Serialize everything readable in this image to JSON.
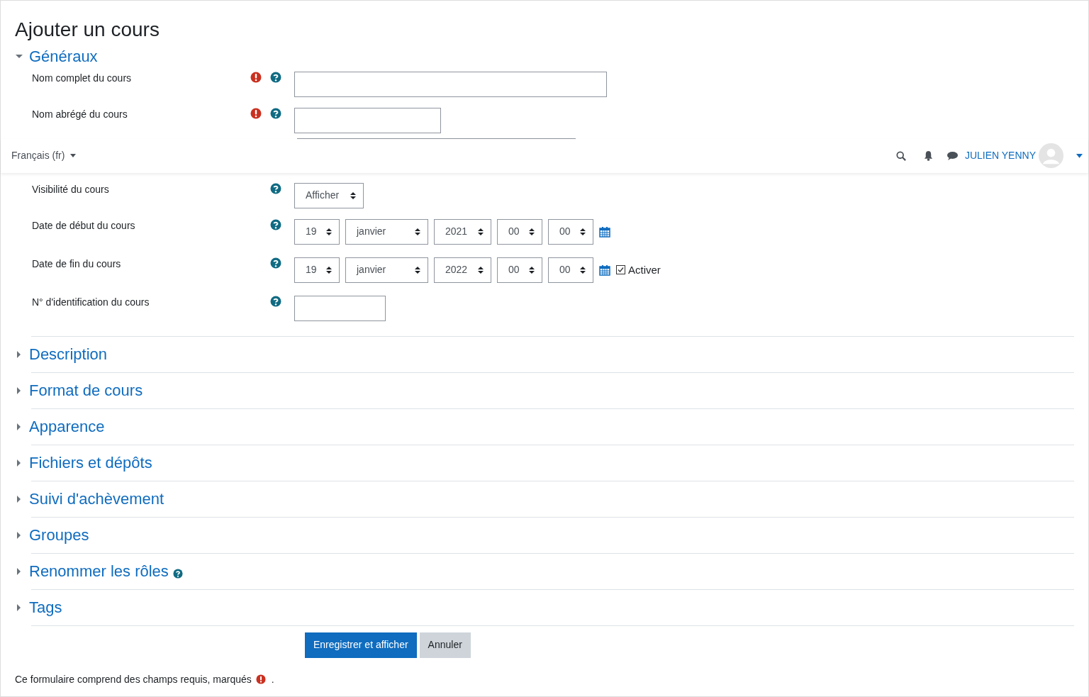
{
  "page_title": "Ajouter un cours",
  "general": {
    "title": "Généraux",
    "expanded": true,
    "fields_above": [
      {
        "label": "Nom complet du cours",
        "required": true,
        "help": true,
        "kind": "long-text"
      },
      {
        "label": "Nom abrégé du cours",
        "required": true,
        "help": true,
        "kind": "short-text"
      }
    ],
    "fields_below": [
      {
        "label": "Visibilité du cours",
        "required": false,
        "help": true,
        "kind": "select",
        "value": "Afficher"
      },
      {
        "label": "Date de début du cours",
        "required": false,
        "help": true,
        "kind": "date",
        "parts": [
          "19",
          "janvier",
          "2021",
          "00",
          "00"
        ]
      },
      {
        "label": "Date de fin du cours",
        "required": false,
        "help": true,
        "kind": "date",
        "parts": [
          "19",
          "janvier",
          "2022",
          "00",
          "00"
        ],
        "enable": {
          "label": "Activer",
          "checked": true
        }
      },
      {
        "label": "N° d'identification du cours",
        "required": false,
        "help": true,
        "kind": "short-text"
      }
    ]
  },
  "navbar": {
    "language": "Français (fr)",
    "user_name": "JULIEN YENNY"
  },
  "sections": [
    {
      "title": "Description",
      "expanded": false,
      "help": false
    },
    {
      "title": "Format de cours",
      "expanded": false,
      "help": false
    },
    {
      "title": "Apparence",
      "expanded": false,
      "help": false
    },
    {
      "title": "Fichiers et dépôts",
      "expanded": false,
      "help": false
    },
    {
      "title": "Suivi d'achèvement",
      "expanded": false,
      "help": false
    },
    {
      "title": "Groupes",
      "expanded": false,
      "help": false
    },
    {
      "title": "Renommer les rôles",
      "expanded": false,
      "help": true
    },
    {
      "title": "Tags",
      "expanded": false,
      "help": false
    }
  ],
  "buttons": [
    {
      "label": "Enregistrer et afficher",
      "kind": "primary"
    },
    {
      "label": "Annuler",
      "kind": "secondary"
    }
  ],
  "footer_note": {
    "text": "Ce formulaire comprend des champs requis, marqués",
    "end": "."
  }
}
